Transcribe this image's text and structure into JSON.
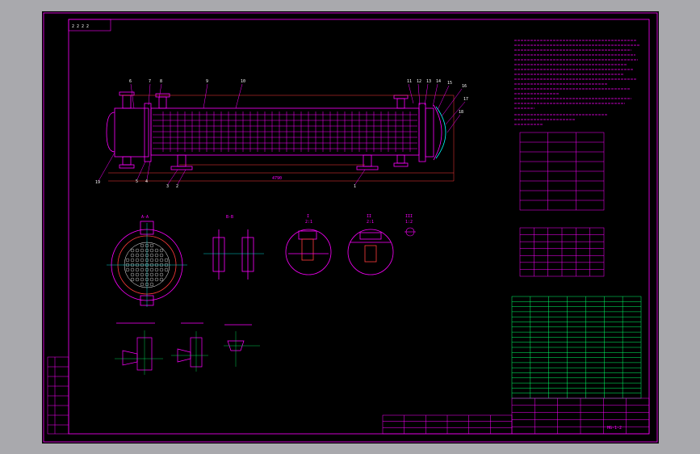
{
  "app": {
    "background": "#a9a9ad",
    "canvas_color": "#000000"
  },
  "colors": {
    "outline": "#ff00ff",
    "dimension": "#ff3b3b",
    "table_grid": "#00ff66",
    "note_text": "#ff00ff",
    "frame": "#ff00ff"
  },
  "drawing": {
    "corner_tag": "2 2 2 2",
    "balloons": [
      "6",
      "7",
      "8",
      "9",
      "10",
      "11",
      "12",
      "13",
      "14",
      "15",
      "16",
      "17",
      "18",
      "19",
      "5",
      "4",
      "3",
      "2",
      "1"
    ],
    "overall_length": "4790",
    "section_titles": [
      "A-A",
      "B-B",
      "I",
      "II",
      "III"
    ],
    "scale_labels": [
      "2:1",
      "2:1",
      "1:2"
    ]
  },
  "design_table": {
    "rows": 8,
    "cols": 3
  },
  "nozzle_table": {
    "rows": 7,
    "cols": 6
  },
  "parts_list": {
    "rows": 20,
    "cols": 7
  },
  "title_block": {
    "drawing_no": "HG-1-2"
  }
}
